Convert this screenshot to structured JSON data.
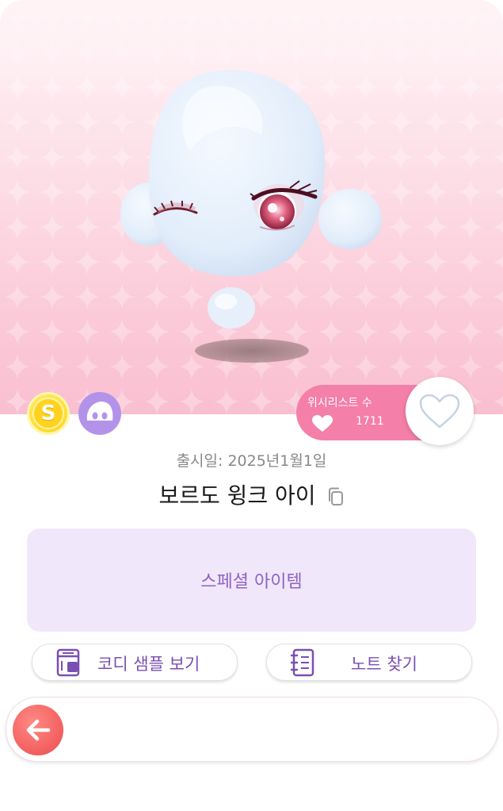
{
  "item": {
    "release_date": "출시일: 2025년1월1일",
    "name": "보르도 윙크 아이",
    "category_badge": "스페셜 아이템"
  },
  "wishlist": {
    "label": "위시리스트 수",
    "count": "1711"
  },
  "badges": {
    "currency_symbol": "S",
    "currency_icon": "coin-icon",
    "type_icon": "face-icon"
  },
  "actions": {
    "codi_sample": "코디 샘플 보기",
    "find_note": "노트 찾기"
  },
  "colors": {
    "accent_pink": "#f47fa8",
    "special_text": "#8e63c4",
    "special_bg": "#f1e7fa",
    "back_button": "#f25e5e"
  }
}
